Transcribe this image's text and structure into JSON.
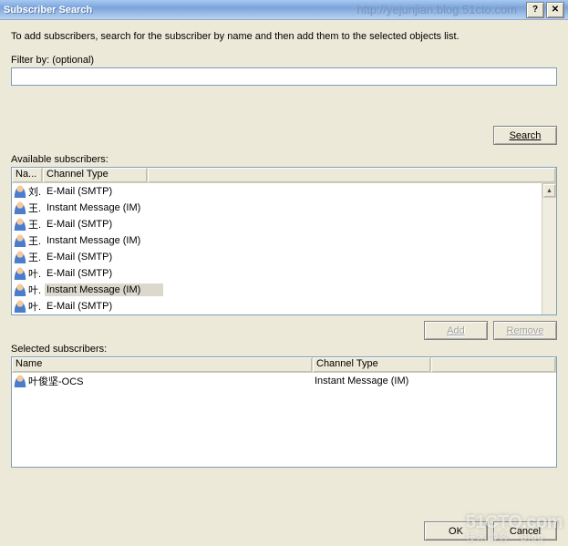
{
  "window": {
    "title": "Subscriber Search",
    "watermark_url": "http://yejunjian.blog.51cto.com",
    "help_glyph": "?",
    "close_glyph": "✕"
  },
  "description": "To add subscribers, search for the subscriber by name and then add them to the selected objects list.",
  "filter": {
    "label": "Filter by: (optional)",
    "value": ""
  },
  "buttons": {
    "search": "Search",
    "add": "Add",
    "remove": "Remove",
    "ok": "OK",
    "cancel": "Cancel"
  },
  "available": {
    "label": "Available subscribers:",
    "columns": {
      "name": "Na...",
      "channel": "Channel Type"
    },
    "rows": [
      {
        "name": "刘.",
        "channel": "E-Mail (SMTP)",
        "selected": false
      },
      {
        "name": "王.",
        "channel": "Instant Message (IM)",
        "selected": false
      },
      {
        "name": "王.",
        "channel": "E-Mail (SMTP)",
        "selected": false
      },
      {
        "name": "王.",
        "channel": "Instant Message (IM)",
        "selected": false
      },
      {
        "name": "王.",
        "channel": "E-Mail (SMTP)",
        "selected": false
      },
      {
        "name": "叶.",
        "channel": "E-Mail (SMTP)",
        "selected": false
      },
      {
        "name": "叶.",
        "channel": "Instant Message (IM)",
        "selected": true
      },
      {
        "name": "叶.",
        "channel": "E-Mail (SMTP)",
        "selected": false
      }
    ]
  },
  "selected": {
    "label": "Selected subscribers:",
    "columns": {
      "name": "Name",
      "channel": "Channel Type"
    },
    "rows": [
      {
        "name": "叶俊坚-OCS",
        "channel": "Instant Message (IM)"
      }
    ]
  },
  "watermark_logo": {
    "line1": "51CTO.com",
    "line2": "技术博客 Blog"
  }
}
